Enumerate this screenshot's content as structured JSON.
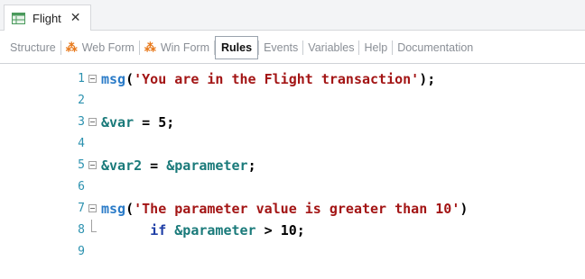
{
  "document_tab": {
    "title": "Flight",
    "close_glyph": "✕",
    "icon": "transaction-grid-icon"
  },
  "subtabs": [
    {
      "label": "Structure",
      "icon": null,
      "active": false
    },
    {
      "label": "Web Form",
      "icon": "form-icon",
      "active": false
    },
    {
      "label": "Win Form",
      "icon": "form-icon",
      "active": false
    },
    {
      "label": "Rules",
      "icon": null,
      "active": true
    },
    {
      "label": "Events",
      "icon": null,
      "active": false
    },
    {
      "label": "Variables",
      "icon": null,
      "active": false
    },
    {
      "label": "Help",
      "icon": null,
      "active": false
    },
    {
      "label": "Documentation",
      "icon": null,
      "active": false
    }
  ],
  "editor": {
    "line_numbers": [
      "1",
      "2",
      "3",
      "4",
      "5",
      "6",
      "7",
      "8",
      "9"
    ],
    "lines": {
      "l1": {
        "fn": "msg",
        "open": "(",
        "str": "'You are in the Flight transaction'",
        "close": ");"
      },
      "l3": {
        "var": "&var",
        "op": " = ",
        "num": "5",
        "end": ";"
      },
      "l5": {
        "var": "&var2",
        "op": " = ",
        "var2": "&parameter",
        "end": ";"
      },
      "l7": {
        "fn": "msg",
        "open": "(",
        "str": "'The parameter value is greater than 10'",
        "close": ")"
      },
      "l8": {
        "indent": "      ",
        "kw": "if",
        "space": " ",
        "var": "&parameter",
        "op": " > ",
        "num": "10",
        "end": ";"
      }
    }
  },
  "colors": {
    "function": "#2a7bc8",
    "string": "#a31515",
    "variable": "#1a7a7a",
    "keyword": "#1f3fa6",
    "line_number": "#2b91af",
    "form_icon": "#e87a1d"
  }
}
